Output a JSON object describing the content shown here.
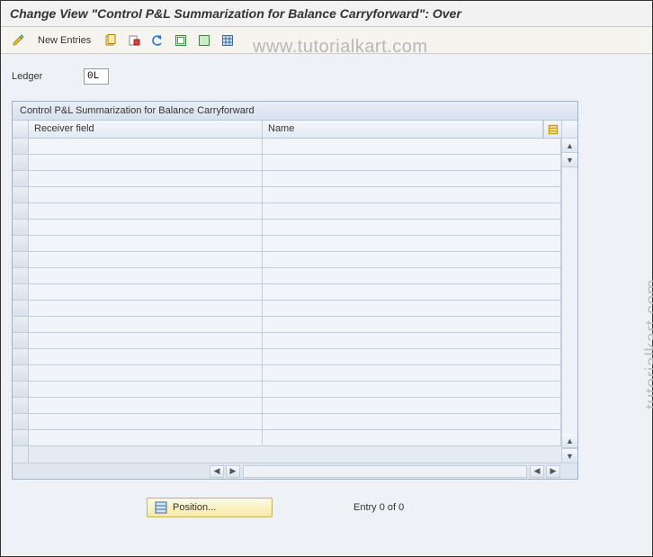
{
  "title": "Change View \"Control P&L Summarization for Balance Carryforward\": Over",
  "toolbar": {
    "new_entries_label": "New Entries"
  },
  "watermark": "www.tutorialkart.com",
  "watermark_side": "tutorialkart.com",
  "ledger": {
    "label": "Ledger",
    "value": "0L"
  },
  "panel": {
    "title": "Control P&L Summarization for Balance Carryforward",
    "columns": {
      "receiver_field": "Receiver field",
      "name": "Name"
    },
    "rows": []
  },
  "footer": {
    "position_label": "Position...",
    "entry_text": "Entry 0 of 0"
  }
}
